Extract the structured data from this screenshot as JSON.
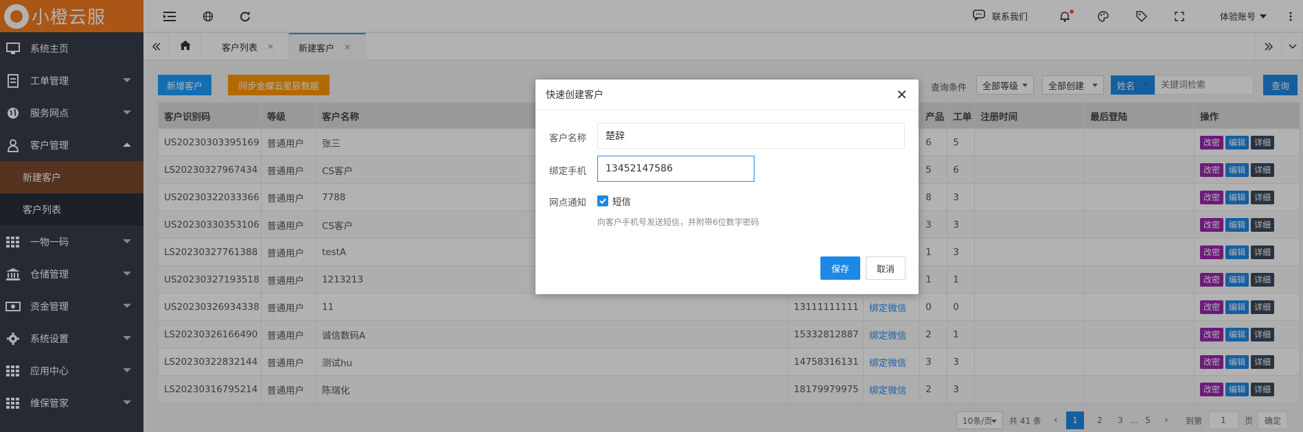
{
  "app": {
    "logo_text": "小橙云服"
  },
  "sidebar": {
    "items": [
      {
        "label": "系统主页",
        "icon": "monitor-icon"
      },
      {
        "label": "工单管理",
        "icon": "document-icon"
      },
      {
        "label": "服务网点",
        "icon": "globe-icon"
      },
      {
        "label": "客户管理",
        "icon": "user-icon"
      },
      {
        "label": "一物一码",
        "icon": "grid-icon"
      },
      {
        "label": "仓储管理",
        "icon": "bank-icon"
      },
      {
        "label": "资金管理",
        "icon": "money-icon"
      },
      {
        "label": "系统设置",
        "icon": "gear-icon"
      },
      {
        "label": "应用中心",
        "icon": "apps-icon"
      },
      {
        "label": "维保管家",
        "icon": "apps-icon"
      }
    ],
    "sub_items": [
      {
        "label": "新建客户"
      },
      {
        "label": "客户列表"
      }
    ]
  },
  "topbar": {
    "contact": "联系我们",
    "account": "体验账号"
  },
  "tabs": [
    {
      "label": "客户列表"
    },
    {
      "label": "新建客户"
    }
  ],
  "toolbar": {
    "add_label": "新增客户",
    "sync_label": "同步金蝶云星辰数据",
    "filter_label": "查询条件",
    "level_select": "全部等级",
    "create_select": "全部创建",
    "field_select": "姓名",
    "search_placeholder": "关键词检索",
    "search_button": "查询"
  },
  "table": {
    "columns": [
      "客户识别码",
      "等级",
      "客户名称",
      "",
      "",
      "产品",
      "工单",
      "注册时间",
      "最后登陆",
      "操作"
    ],
    "rows": [
      {
        "code": "US20230303395169",
        "level": "普通用户",
        "name": "张三",
        "phone": "",
        "wechat": "",
        "products": "6",
        "orders": "5"
      },
      {
        "code": "LS20230327967434",
        "level": "普通用户",
        "name": "CS客户",
        "phone": "",
        "wechat": "",
        "products": "5",
        "orders": "6"
      },
      {
        "code": "US20230322033366",
        "level": "普通用户",
        "name": "7788",
        "phone": "",
        "wechat": "",
        "products": "8",
        "orders": "3"
      },
      {
        "code": "US20230330353106",
        "level": "普通用户",
        "name": "CS客户",
        "phone": "",
        "wechat": "",
        "products": "3",
        "orders": "3"
      },
      {
        "code": "LS20230327761388",
        "level": "普通用户",
        "name": "testA",
        "phone": "",
        "wechat": "",
        "products": "1",
        "orders": "3"
      },
      {
        "code": "US20230327193518",
        "level": "普通用户",
        "name": "1213213",
        "phone": "",
        "wechat": "",
        "products": "1",
        "orders": "1"
      },
      {
        "code": "US20230326934338",
        "level": "普通用户",
        "name": "11",
        "phone": "13111111111",
        "wechat": "绑定微信",
        "products": "0",
        "orders": "0"
      },
      {
        "code": "LS20230326166490",
        "level": "普通用户",
        "name": "诚信数码A",
        "phone": "15332812887",
        "wechat": "绑定微信",
        "products": "2",
        "orders": "1"
      },
      {
        "code": "LS20230322832144",
        "level": "普通用户",
        "name": "测试hu",
        "phone": "14758316131",
        "wechat": "绑定微信",
        "products": "3",
        "orders": "3"
      },
      {
        "code": "LS20230316795214",
        "level": "普通用户",
        "name": "陈瑞化",
        "phone": "18179979975",
        "wechat": "绑定微信",
        "products": "2",
        "orders": "3"
      }
    ],
    "ops": [
      "改密",
      "编辑",
      "详细"
    ]
  },
  "pager": {
    "per_page": "10条/页",
    "total": "共 41 条",
    "pages": [
      "1",
      "2",
      "3",
      "...",
      "5"
    ],
    "goto_label": "到第",
    "goto_value": "1",
    "page_unit": "页",
    "confirm": "确定"
  },
  "modal": {
    "title": "快速创建客户",
    "name_label": "客户名称",
    "name_value": "楚辞",
    "phone_label": "绑定手机",
    "phone_value": "13452147586",
    "notify_label": "网点通知",
    "sms_label": "短信",
    "hint": "向客户手机号发送短信，并附带6位数字密码",
    "save": "保存",
    "cancel": "取消"
  },
  "colors": {
    "sidebar": "#393d49",
    "brand": "#f47b20",
    "primary": "#1e9fff",
    "save": "#1e88e5",
    "purple": "#9c27b0",
    "blue": "#1e88e5",
    "dark": "#3c4a5c"
  }
}
